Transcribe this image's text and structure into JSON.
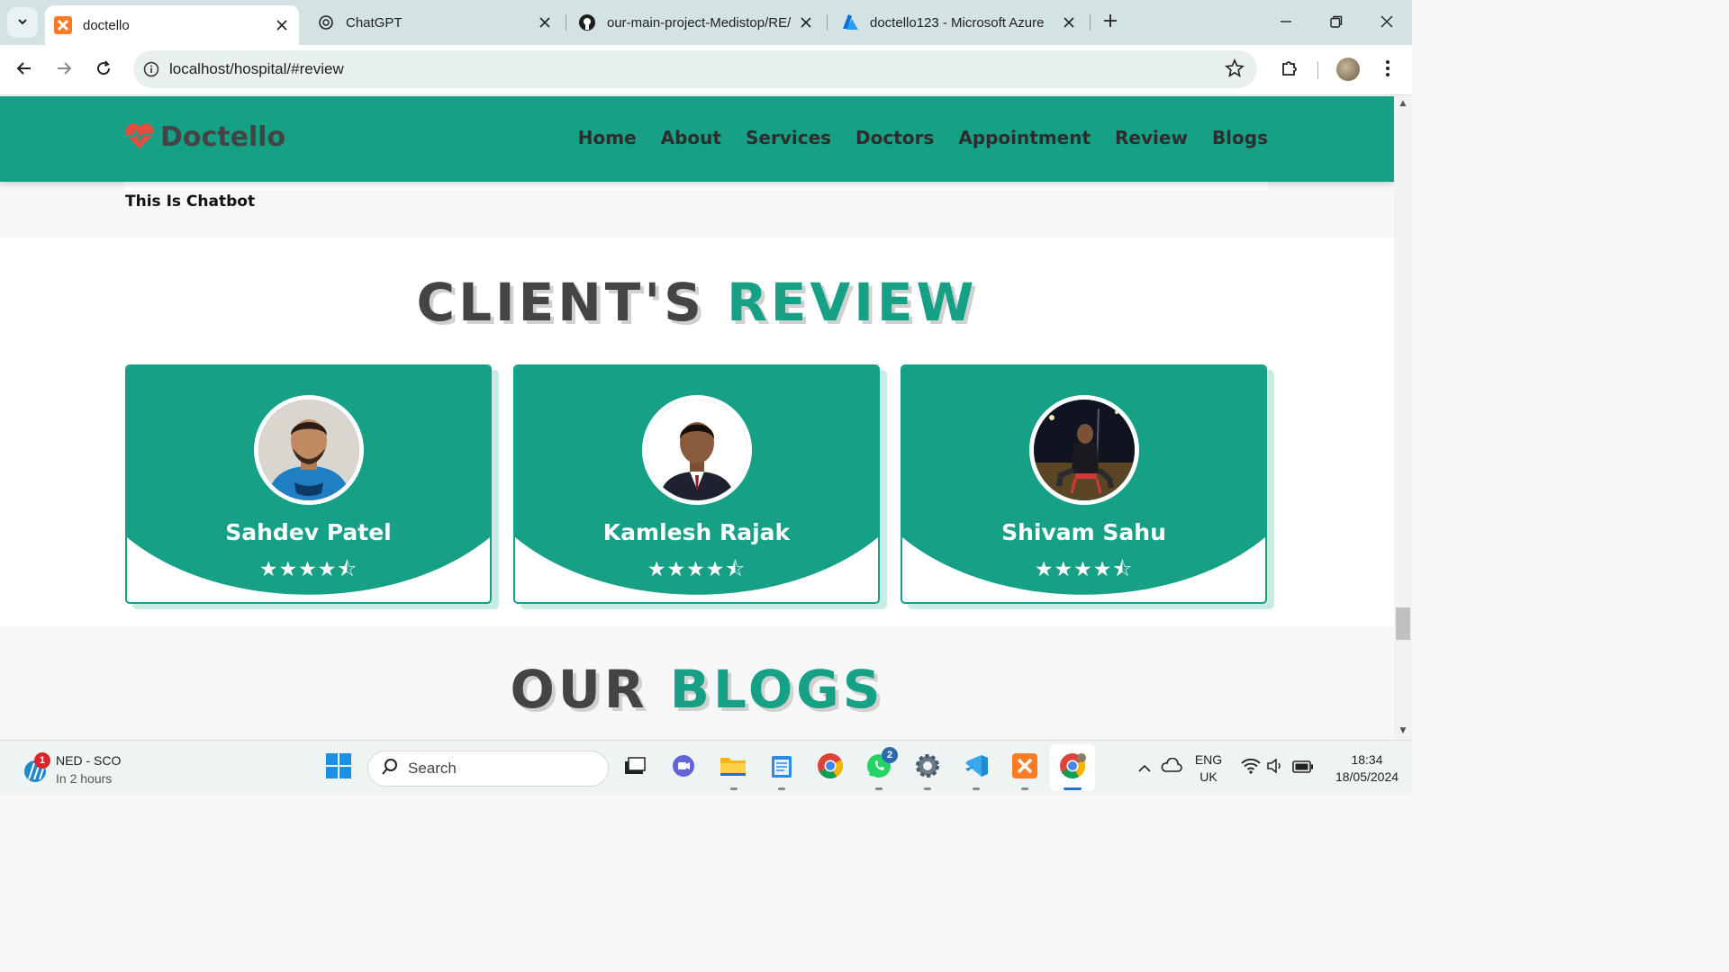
{
  "browser": {
    "tabs": [
      {
        "title": "doctello",
        "icon": "xampp-icon",
        "active": true
      },
      {
        "title": "ChatGPT",
        "icon": "chatgpt-icon",
        "active": false
      },
      {
        "title": "our-main-project-Medistop/RE/",
        "icon": "github-icon",
        "active": false
      },
      {
        "title": "doctello123 - Microsoft Azure",
        "icon": "azure-icon",
        "active": false
      }
    ],
    "url": "localhost/hospital/#review"
  },
  "site": {
    "logo": "Doctello",
    "nav": [
      "Home",
      "About",
      "Services",
      "Doctors",
      "Appointment",
      "Review",
      "Blogs"
    ],
    "chatbot_title": "This Is Chatbot",
    "review_heading": {
      "dark": "CLIENT'S",
      "accent": "REVIEW"
    },
    "reviews": [
      {
        "name": "Sahdev Patel",
        "stars": "★★★★⯪",
        "rating": 4.5
      },
      {
        "name": "Kamlesh Rajak",
        "stars": "★★★★⯪",
        "rating": 4.5
      },
      {
        "name": "Shivam Sahu",
        "stars": "★★★★⯪",
        "rating": 4.5
      }
    ],
    "blogs_heading": {
      "dark": "OUR",
      "accent": "BLOGS"
    },
    "colors": {
      "accent": "#16a085",
      "dark": "#444444"
    }
  },
  "taskbar": {
    "weather": {
      "title": "NED - SCO",
      "subtitle": "In 2 hours",
      "badge": "1"
    },
    "search_label": "Search",
    "whatsapp_badge": "2",
    "lang": {
      "line1": "ENG",
      "line2": "UK"
    },
    "clock": {
      "time": "18:34",
      "date": "18/05/2024"
    }
  }
}
